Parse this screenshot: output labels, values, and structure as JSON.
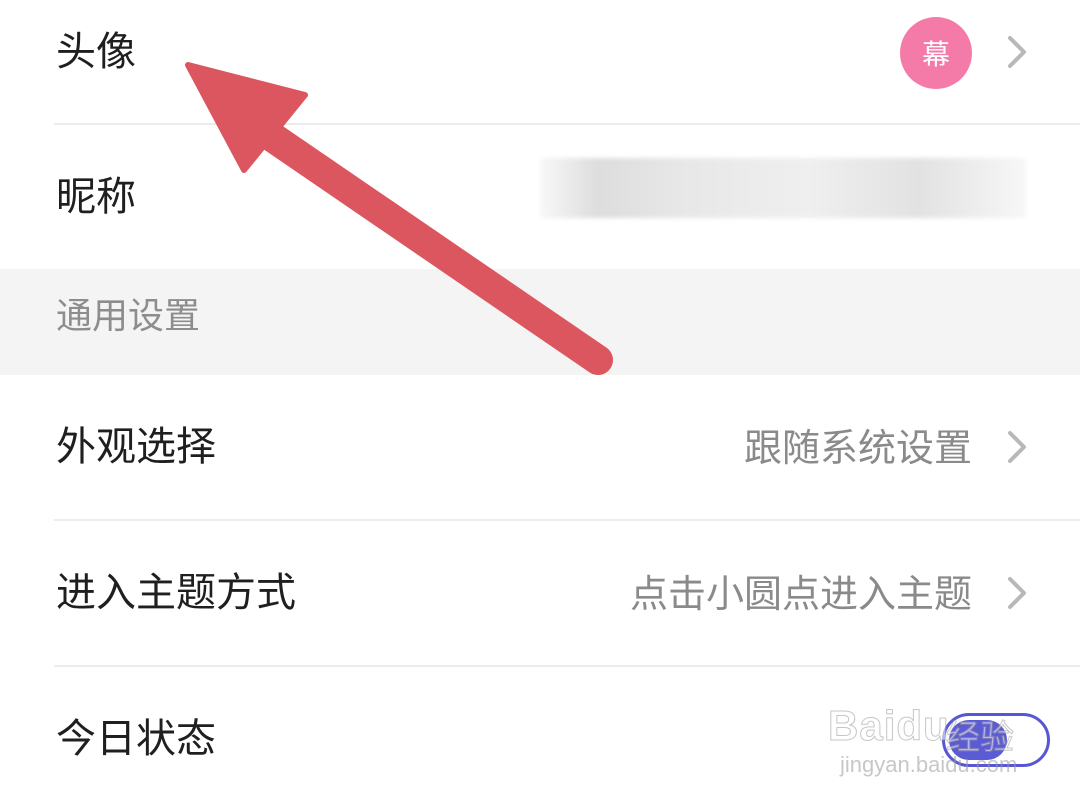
{
  "profile": {
    "avatar_label": "头像",
    "avatar_char": "幕",
    "nickname_label": "昵称"
  },
  "section": {
    "general_title": "通用设置"
  },
  "settings": [
    {
      "label": "外观选择",
      "value": "跟随系统设置"
    },
    {
      "label": "进入主题方式",
      "value": "点击小圆点进入主题"
    },
    {
      "label": "今日状态",
      "toggle_on": true
    }
  ],
  "watermark": {
    "brand": "Baidu",
    "cn": "经验",
    "url": "jingyan.baidu.com"
  },
  "colors": {
    "avatar_bg": "#f47aa8",
    "toggle_accent": "#5b5bd6",
    "arrow": "#dc5660"
  },
  "icons": {
    "chevron": "chevron-right-icon",
    "arrow": "red-arrow-annotation"
  }
}
